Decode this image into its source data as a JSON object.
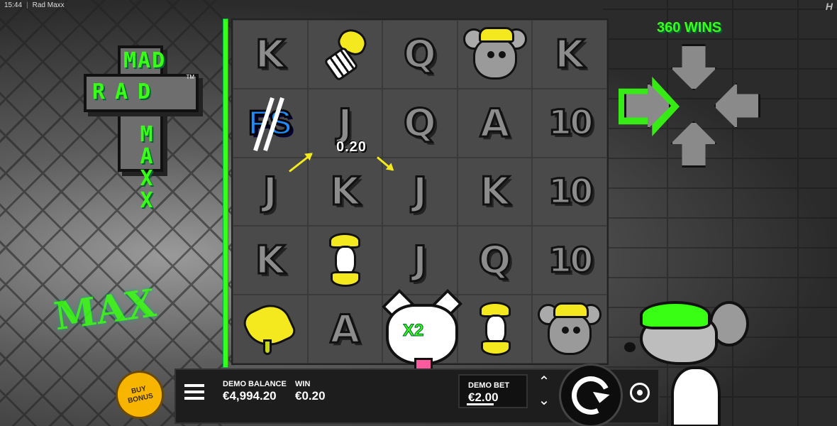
{
  "topbar": {
    "time": "15:44",
    "title": "Rad Maxx",
    "provider_mark": "H"
  },
  "logo": {
    "word1": "MAD",
    "word2": "RAD",
    "word3": "MAXX",
    "tm": "TM"
  },
  "graffiti": "MAX",
  "grid": {
    "rows": [
      [
        "K",
        "fishbone-symbol",
        "Q",
        "rat-symbol",
        "K"
      ],
      [
        "FS",
        "J",
        "Q",
        "A",
        "10"
      ],
      [
        "J",
        "K",
        "J",
        "K",
        "10"
      ],
      [
        "K",
        "apple-core-symbol",
        "J",
        "Q",
        "10"
      ],
      [
        "pizza-symbol",
        "A",
        "cat-wild-symbol",
        "apple-core-symbol",
        "rat-symbol"
      ]
    ],
    "scatter_label": "FS",
    "cat_multiplier": "X2",
    "line_win": "0.20"
  },
  "wins_counter": "360 WINS",
  "direction_arrows": {
    "active": "right"
  },
  "colors": {
    "accent": "#39ff14",
    "symbol_yellow": "#f4e81f",
    "buy_bonus": "#f7b500",
    "scatter_blue": "#1e8bff"
  },
  "hud": {
    "buy_bonus_label": "BUY BONUS",
    "balance_label": "DEMO BALANCE",
    "balance_value": "€4,994.20",
    "win_label": "WIN",
    "win_value": "€0.20",
    "bet_label": "DEMO BET",
    "bet_value": "€2.00",
    "stepper_up": "⌃",
    "stepper_down": "⌄"
  }
}
